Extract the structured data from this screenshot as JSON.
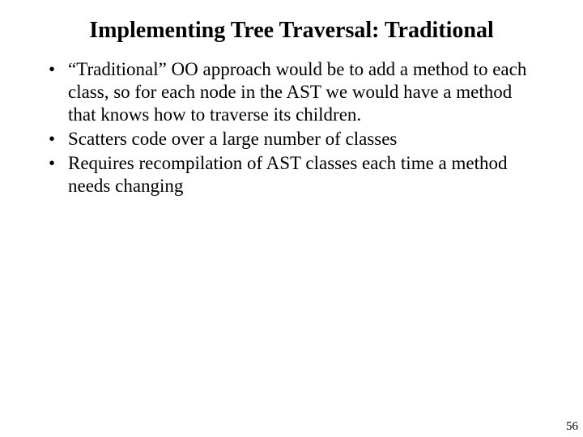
{
  "title": "Implementing Tree Traversal: Traditional",
  "bullets": [
    "“Traditional” OO approach would be to add a method to each class, so for each node in the AST we would have a method that knows how to traverse its children.",
    "Scatters code over a large number of classes",
    "Requires recompilation of AST classes each time a method needs changing"
  ],
  "page_number": "56"
}
